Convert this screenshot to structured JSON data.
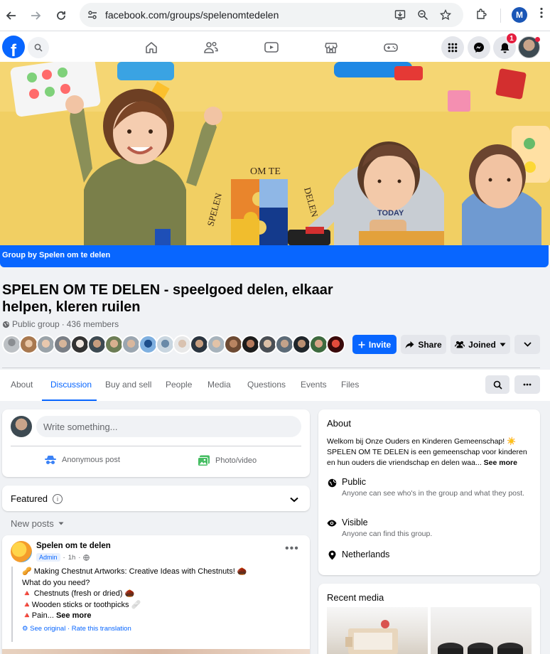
{
  "browser": {
    "url": "facebook.com/groups/spelenomtedelen",
    "profile_initial": "M"
  },
  "fbnav": {
    "notification_count": "1"
  },
  "cover": {
    "logo_text_top": "OM TE",
    "logo_text_left": "SPELEN",
    "logo_text_right": "DELEN",
    "shirt_text": "TODAY",
    "band_label": "Group by Spelen om te delen"
  },
  "group": {
    "title": "SPELEN OM TE DELEN - speelgoed delen, elkaar helpen, kleren ruilen",
    "privacy": "Public group",
    "separator": "·",
    "members": "436 members",
    "buttons": {
      "invite": "Invite",
      "share": "Share",
      "joined": "Joined"
    }
  },
  "tabs": [
    "About",
    "Discussion",
    "Buy and sell",
    "People",
    "Media",
    "Questions",
    "Events",
    "Files"
  ],
  "composer": {
    "placeholder": "Write something...",
    "anonymous": "Anonymous post",
    "photo": "Photo/video"
  },
  "featured": {
    "label": "Featured"
  },
  "feed": {
    "sort_label": "New posts"
  },
  "post": {
    "author": "Spelen om te delen",
    "badge": "Admin",
    "time": "1h",
    "lines": [
      "Making Chestnut Artworks: Creative Ideas with Chestnuts!",
      "What do you need?",
      "Chestnuts (fresh or dried)",
      "Wooden sticks or toothpicks",
      "Pain..."
    ],
    "see_more": "See more",
    "see_original": "See original",
    "translation_sep": "·",
    "rate": "Rate this translation"
  },
  "about": {
    "heading": "About",
    "description": "Welkom bij Onze Ouders en Kinderen Gemeenschap! ☀️ SPELEN OM TE DELEN is een gemeenschap voor kinderen en hun ouders die vriendschap en delen waa...",
    "see_more": "See more",
    "public_title": "Public",
    "public_desc": "Anyone can see who's in the group and what they post.",
    "visible_title": "Visible",
    "visible_desc": "Anyone can find this group.",
    "location": "Netherlands"
  },
  "recent_media": {
    "heading": "Recent media"
  },
  "colors": {
    "fb_blue": "#0866ff",
    "notification_red": "#e41e3f",
    "cover_yellow": "#f3d36a"
  }
}
